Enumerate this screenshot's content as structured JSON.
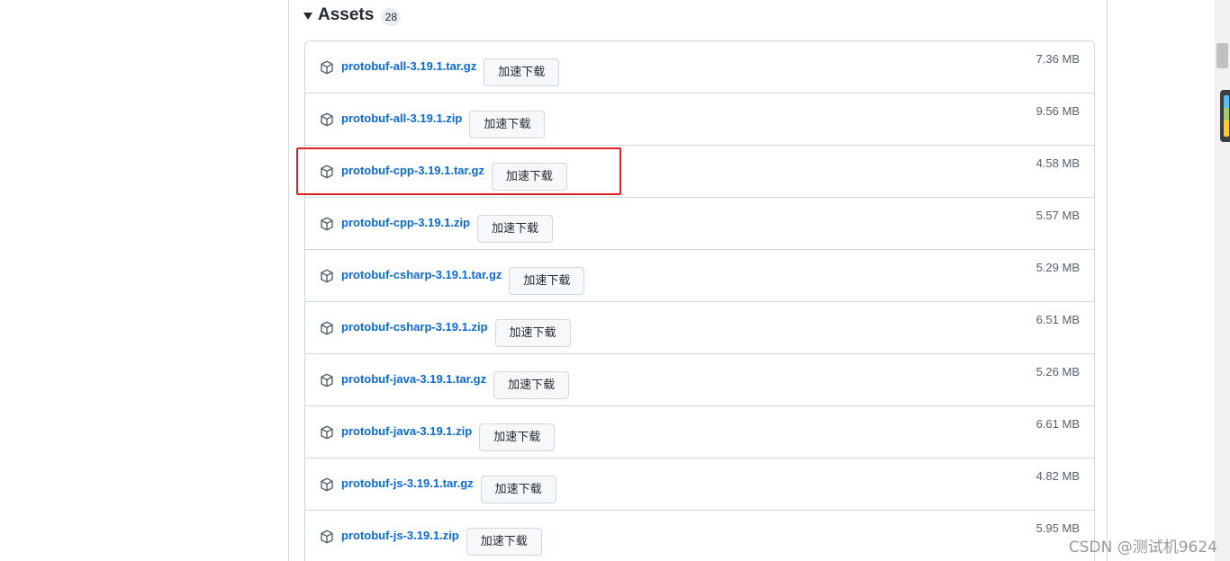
{
  "assets": {
    "title": "Assets",
    "count": "28",
    "download_label": "加速下载",
    "items": [
      {
        "name": "protobuf-all-3.19.1.tar.gz",
        "size": "7.36 MB"
      },
      {
        "name": "protobuf-all-3.19.1.zip",
        "size": "9.56 MB"
      },
      {
        "name": "protobuf-cpp-3.19.1.tar.gz",
        "size": "4.58 MB"
      },
      {
        "name": "protobuf-cpp-3.19.1.zip",
        "size": "5.57 MB"
      },
      {
        "name": "protobuf-csharp-3.19.1.tar.gz",
        "size": "5.29 MB"
      },
      {
        "name": "protobuf-csharp-3.19.1.zip",
        "size": "6.51 MB"
      },
      {
        "name": "protobuf-java-3.19.1.tar.gz",
        "size": "5.26 MB"
      },
      {
        "name": "protobuf-java-3.19.1.zip",
        "size": "6.61 MB"
      },
      {
        "name": "protobuf-js-3.19.1.tar.gz",
        "size": "4.82 MB"
      },
      {
        "name": "protobuf-js-3.19.1.zip",
        "size": "5.95 MB"
      }
    ]
  },
  "highlighted_item": "protobuf-cpp-3.19.1.tar.gz",
  "watermark": "CSDN @测试机9624",
  "colors": {
    "link": "#0969da",
    "highlight": "#e02020",
    "border": "#d0d7de"
  },
  "icons": {
    "asset": "package-icon",
    "toggle": "caret-down-icon"
  }
}
